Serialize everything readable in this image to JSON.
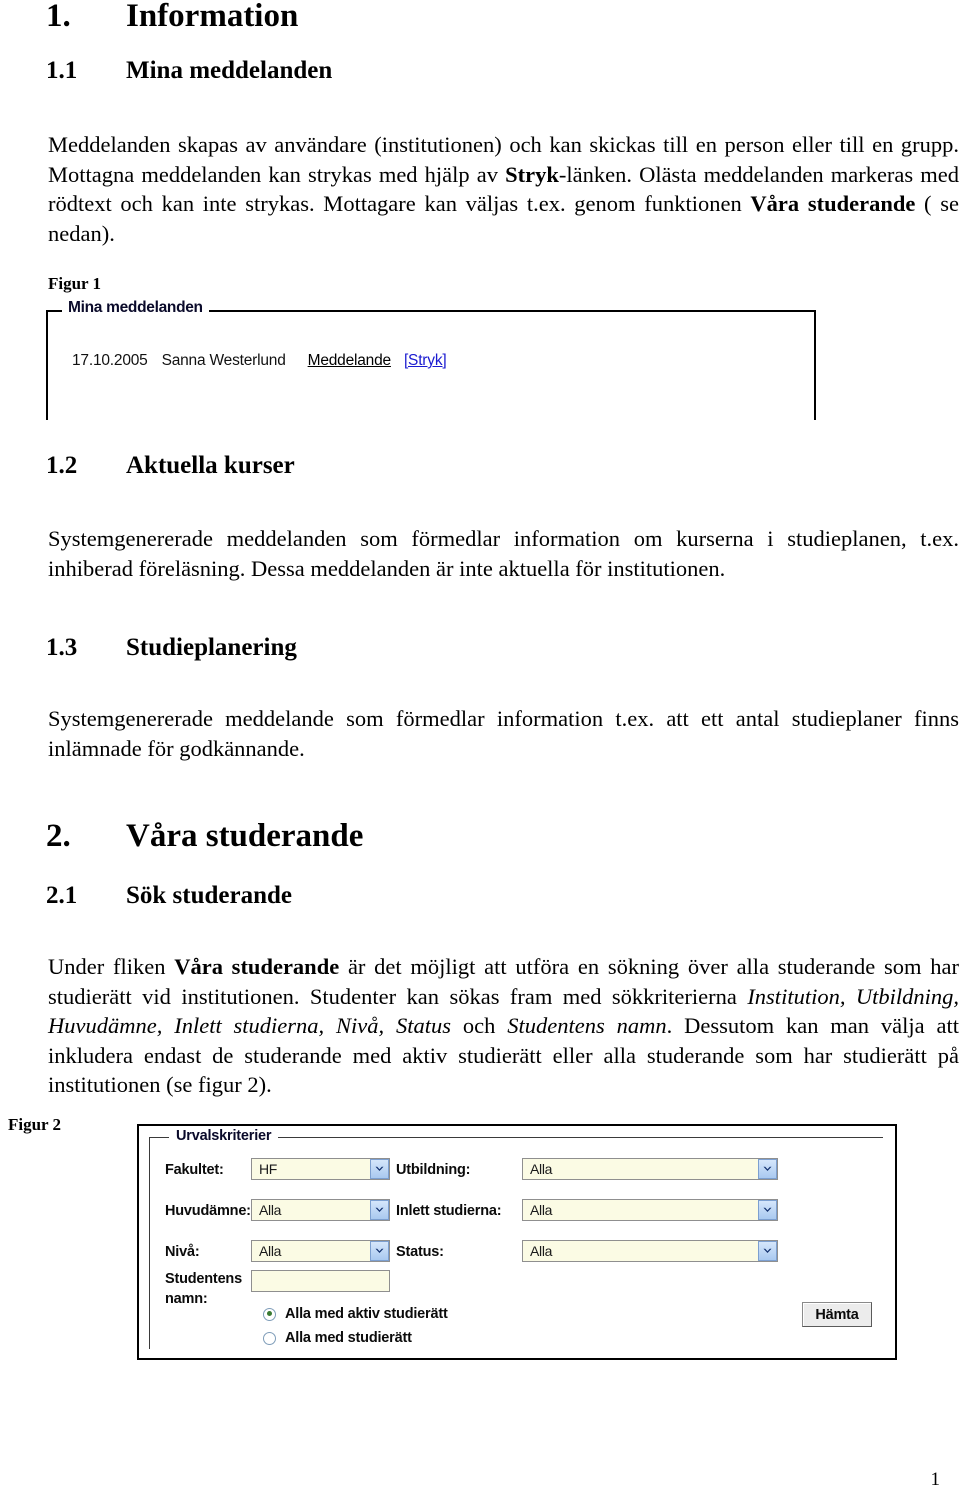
{
  "document": {
    "page_number": "1"
  },
  "sections": {
    "s1": {
      "number": "1.",
      "title": "Information"
    },
    "s1_1": {
      "number": "1.1",
      "title": "Mina meddelanden",
      "paragraph_parts": {
        "p1": "Meddelanden skapas av användare (institutionen) och kan skickas till en person eller till en grupp. Mottagna meddelanden kan strykas med hjälp av ",
        "bold1": "Stryk",
        "p2": "-länken. Olästa meddelanden markeras med rödtext och kan inte strykas. Mottagare kan väljas t.ex. genom funktionen ",
        "bold2": "Våra studerande",
        "p3": " ( se nedan)."
      }
    },
    "s1_2": {
      "number": "1.2",
      "title": "Aktuella kurser",
      "paragraph": "Systemgenererade meddelanden som förmedlar information om kurserna i studieplanen, t.ex. inhiberad föreläsning. Dessa meddelanden är inte aktuella för institutionen."
    },
    "s1_3": {
      "number": "1.3",
      "title": "Studieplanering",
      "paragraph": "Systemgenererade meddelande som förmedlar information t.ex. att ett antal studieplaner finns inlämnade för godkännande."
    },
    "s2": {
      "number": "2.",
      "title": "Våra studerande"
    },
    "s2_1": {
      "number": "2.1",
      "title": "Sök studerande",
      "paragraph_parts": {
        "p1": "Under fliken ",
        "bold1": "Våra studerande",
        "p2": " är det möjligt att utföra en sökning över alla studerande som har studierätt vid institutionen. Studenter kan sökas fram med sökkriterierna ",
        "italic1": "Institution, Utbildning, Huvudämne, Inlett studierna, Nivå, Status",
        "p3": " och ",
        "italic2": "Studentens namn",
        "p4": ". Dessutom kan man välja att inkludera endast de studerande med aktiv studierätt eller alla studerande som har studierätt på institutionen (se figur 2)."
      }
    }
  },
  "figure1": {
    "caption": "Figur 1",
    "legend": "Mina meddelanden",
    "message": {
      "date": "17.10.2005",
      "sender": "Sanna Westerlund",
      "link_message": "Meddelande",
      "link_delete": "[Stryk]",
      "link_delete_color": "#1a1ad0"
    }
  },
  "figure2": {
    "caption": "Figur 2",
    "legend": "Urvalskriterier",
    "fields": {
      "fakultet": {
        "label": "Fakultet:",
        "value": "HF"
      },
      "utbildning": {
        "label": "Utbildning:",
        "value": "Alla"
      },
      "huvudamne": {
        "label": "Huvudämne:",
        "value": "Alla"
      },
      "inlett": {
        "label": "Inlett studierna:",
        "value": "Alla"
      },
      "niva": {
        "label": "Nivå:",
        "value": "Alla"
      },
      "status": {
        "label": "Status:",
        "value": "Alla"
      },
      "studentens_namn": {
        "label_line1": "Studentens",
        "label_line2": "namn:",
        "value": ""
      }
    },
    "radios": [
      {
        "label": "Alla med aktiv studierätt",
        "selected": true
      },
      {
        "label": "Alla med studierätt",
        "selected": false
      }
    ],
    "submit_button": "Hämta"
  }
}
